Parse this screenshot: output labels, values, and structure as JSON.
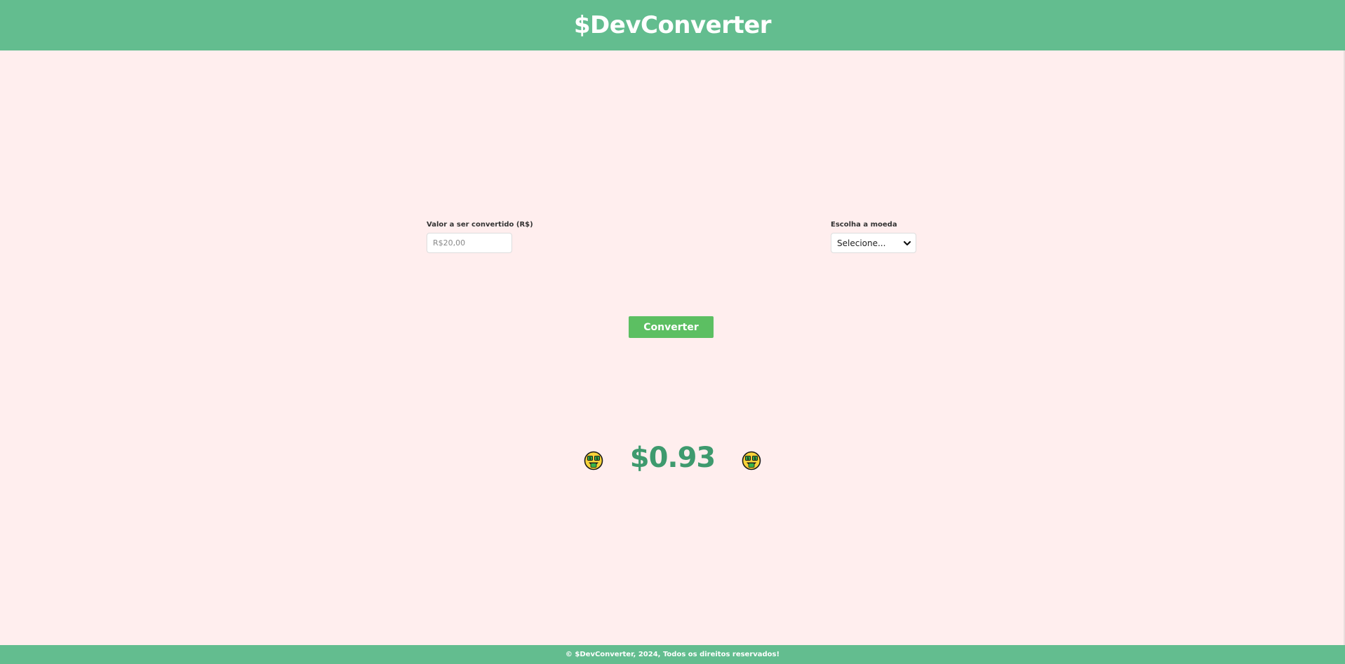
{
  "header": {
    "title": "$DevConverter"
  },
  "form": {
    "amount": {
      "label": "Valor a ser convertido (R$)",
      "placeholder": "R$20,00",
      "value": ""
    },
    "currency": {
      "label": "Escolha a moeda",
      "selected": "Selecione..."
    },
    "convert_label": "Converter"
  },
  "result": {
    "value": "$0.93",
    "icon": "money-mouth-face-icon"
  },
  "footer": {
    "text": "© $DevConverter, 2024, Todos os direitos reservados!"
  },
  "colors": {
    "header_bg": "#63BD8F",
    "page_bg": "#FFEEEE",
    "button_bg": "#5CBF62",
    "result_text": "#3E9A6E"
  }
}
